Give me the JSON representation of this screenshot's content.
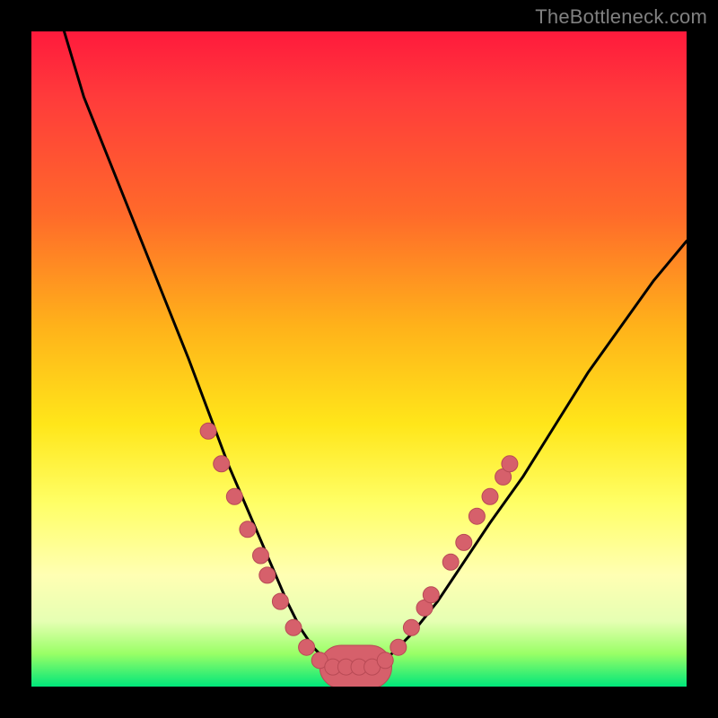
{
  "watermark": "TheBottleneck.com",
  "colors": {
    "background": "#000000",
    "curve": "#000000",
    "marker_fill": "#d6606b",
    "marker_stroke": "#b84a55"
  },
  "chart_data": {
    "type": "line",
    "title": "",
    "xlabel": "",
    "ylabel": "",
    "xlim": [
      0,
      100
    ],
    "ylim": [
      0,
      100
    ],
    "grid": false,
    "legend": false,
    "series": [
      {
        "name": "bottleneck-curve",
        "x": [
          5,
          8,
          12,
          16,
          20,
          24,
          27,
          30,
          33,
          36,
          39,
          41,
          43,
          45,
          47,
          49,
          52,
          55,
          58,
          62,
          66,
          70,
          75,
          80,
          85,
          90,
          95,
          100
        ],
        "y": [
          100,
          90,
          80,
          70,
          60,
          50,
          42,
          34,
          27,
          20,
          13,
          9,
          6,
          4,
          3,
          3,
          3,
          5,
          8,
          13,
          19,
          25,
          32,
          40,
          48,
          55,
          62,
          68
        ]
      }
    ],
    "markers": {
      "name": "highlighted-points",
      "points": [
        {
          "x": 27,
          "y": 39
        },
        {
          "x": 29,
          "y": 34
        },
        {
          "x": 31,
          "y": 29
        },
        {
          "x": 33,
          "y": 24
        },
        {
          "x": 35,
          "y": 20
        },
        {
          "x": 36,
          "y": 17
        },
        {
          "x": 38,
          "y": 13
        },
        {
          "x": 40,
          "y": 9
        },
        {
          "x": 42,
          "y": 6
        },
        {
          "x": 44,
          "y": 4
        },
        {
          "x": 46,
          "y": 3
        },
        {
          "x": 48,
          "y": 3
        },
        {
          "x": 50,
          "y": 3
        },
        {
          "x": 52,
          "y": 3
        },
        {
          "x": 54,
          "y": 4
        },
        {
          "x": 56,
          "y": 6
        },
        {
          "x": 58,
          "y": 9
        },
        {
          "x": 60,
          "y": 12
        },
        {
          "x": 61,
          "y": 14
        },
        {
          "x": 64,
          "y": 19
        },
        {
          "x": 66,
          "y": 22
        },
        {
          "x": 68,
          "y": 26
        },
        {
          "x": 70,
          "y": 29
        },
        {
          "x": 72,
          "y": 32
        },
        {
          "x": 73,
          "y": 34
        }
      ]
    },
    "flat_bar": {
      "x_start": 44,
      "x_end": 55,
      "y": 3,
      "thickness": 3
    }
  }
}
